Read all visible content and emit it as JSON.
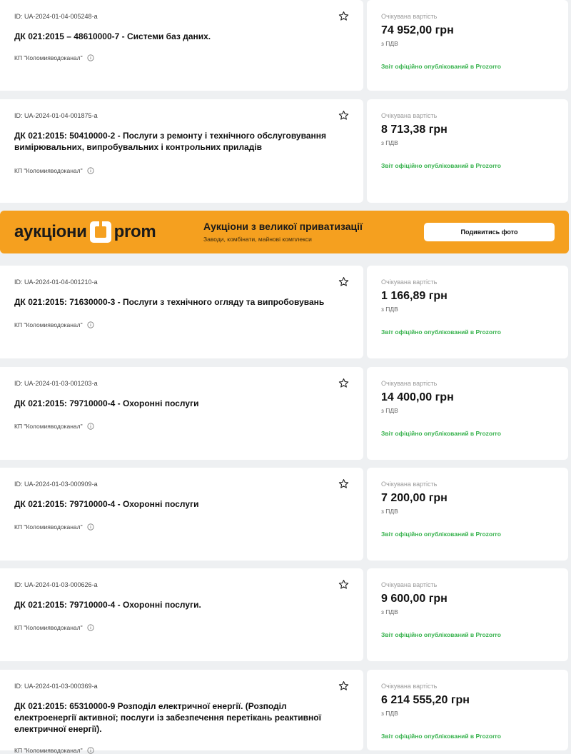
{
  "tenders": [
    {
      "id": "ID: UA-2024-01-04-005248-a",
      "title": "ДК 021:2015 – 48610000-7 - Системи баз даних.",
      "org": "КП \"Коломияводоканал\"",
      "expected_label": "Очікувана вартість",
      "amount": "74 952,00 грн",
      "vat": "з ПДВ",
      "report": "Звіт офіційно опублікований в Prozorro"
    },
    {
      "id": "ID: UA-2024-01-04-001875-a",
      "title": "ДК 021:2015: 50410000-2 - Послуги з ремонту і технічного обслуговування вимірювальних, випробувальних і контрольних приладів",
      "org": "КП \"Коломияводоканал\"",
      "expected_label": "Очікувана вартість",
      "amount": "8 713,38 грн",
      "vat": "з ПДВ",
      "report": "Звіт офіційно опублікований в Prozorro"
    },
    {
      "id": "ID: UA-2024-01-04-001210-a",
      "title": "ДК 021:2015: 71630000-3 - Послуги з технічного огляду та випробовувань",
      "org": "КП \"Коломияводоканал\"",
      "expected_label": "Очікувана вартість",
      "amount": "1 166,89 грн",
      "vat": "з ПДВ",
      "report": "Звіт офіційно опублікований в Prozorro"
    },
    {
      "id": "ID: UA-2024-01-03-001203-a",
      "title": "ДК 021:2015: 79710000-4 - Охоронні послуги",
      "org": "КП \"Коломияводоканал\"",
      "expected_label": "Очікувана вартість",
      "amount": "14 400,00 грн",
      "vat": "з ПДВ",
      "report": "Звіт офіційно опублікований в Prozorro"
    },
    {
      "id": "ID: UA-2024-01-03-000909-a",
      "title": "ДК 021:2015: 79710000-4 - Охоронні послуги",
      "org": "КП \"Коломияводоканал\"",
      "expected_label": "Очікувана вартість",
      "amount": "7 200,00 грн",
      "vat": "з ПДВ",
      "report": "Звіт офіційно опублікований в Prozorro"
    },
    {
      "id": "ID: UA-2024-01-03-000626-a",
      "title": "ДК 021:2015: 79710000-4 - Охоронні послуги.",
      "org": "КП \"Коломияводоканал\"",
      "expected_label": "Очікувана вартість",
      "amount": "9 600,00 грн",
      "vat": "з ПДВ",
      "report": "Звіт офіційно опублікований в Prozorro"
    },
    {
      "id": "ID: UA-2024-01-03-000369-a",
      "title": "ДК 021:2015: 65310000-9 Розподіл електричної енергії. (Розподіл електроенергії активної; послуги із забезпечення перетікань реактивної електричної енергії).",
      "org": "КП \"Коломияводоканал\"",
      "expected_label": "Очікувана вартість",
      "amount": "6 214 555,20 грн",
      "vat": "з ПДВ",
      "report": "Звіт офіційно опублікований в Prozorro"
    }
  ],
  "banner": {
    "logo_word1": "аукціони",
    "logo_word2": "prom",
    "title": "Аукціони з великої приватизації",
    "subtitle": "Заводи, комбінати, майнові комплекси",
    "button": "Подивитись фото",
    "color": "#f5a01f"
  },
  "colors": {
    "report_green": "#37b24d",
    "background": "#eef0f2"
  },
  "icons": {
    "favorite": "star-outline-icon",
    "org_info": "info-circle-icon"
  }
}
